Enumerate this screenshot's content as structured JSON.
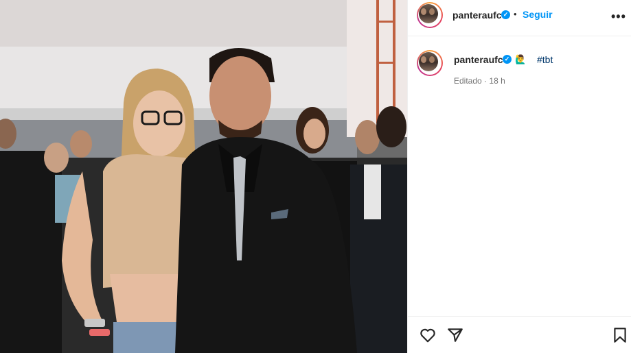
{
  "post": {
    "username": "panteraufc",
    "follow_label": "Seguir",
    "separator": "•",
    "more_label": "•••",
    "caption_username": "panteraufc",
    "caption_emoji": "🙋‍♂",
    "caption_hashtag": "#tbt",
    "edited_label": "Editado",
    "meta_separator": "·",
    "timestamp": "18 h",
    "verified_mark": "✓"
  },
  "colors": {
    "follow": "#0095f6",
    "verified": "#0095f6",
    "hashtag": "#00376b",
    "meta": "#737373",
    "text": "#262626"
  },
  "icons": [
    "heart-icon",
    "share-icon",
    "bookmark-icon",
    "more-icon",
    "verified-icon"
  ]
}
